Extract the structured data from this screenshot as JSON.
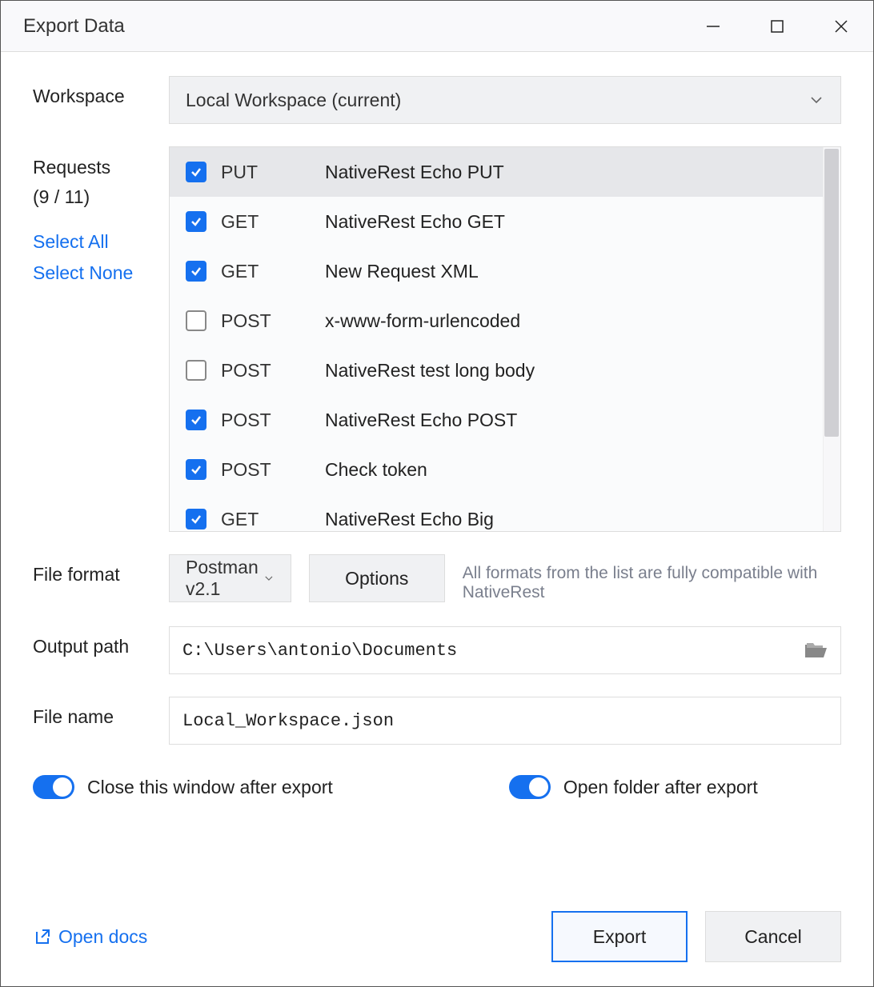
{
  "window": {
    "title": "Export Data"
  },
  "workspace": {
    "label": "Workspace",
    "value": "Local Workspace (current)"
  },
  "requests": {
    "label": "Requests",
    "count_label": "(9 / 11)",
    "select_all": "Select All",
    "select_none": "Select None",
    "items": [
      {
        "checked": true,
        "method": "PUT",
        "name": "NativeRest Echo PUT",
        "selected": true
      },
      {
        "checked": true,
        "method": "GET",
        "name": "NativeRest Echo GET",
        "selected": false
      },
      {
        "checked": true,
        "method": "GET",
        "name": "New Request XML",
        "selected": false
      },
      {
        "checked": false,
        "method": "POST",
        "name": "x-www-form-urlencoded",
        "selected": false
      },
      {
        "checked": false,
        "method": "POST",
        "name": "NativeRest test long body",
        "selected": false
      },
      {
        "checked": true,
        "method": "POST",
        "name": "NativeRest Echo POST",
        "selected": false
      },
      {
        "checked": true,
        "method": "POST",
        "name": "Check token",
        "selected": false
      },
      {
        "checked": true,
        "method": "GET",
        "name": "NativeRest Echo Big",
        "selected": false
      }
    ]
  },
  "format": {
    "label": "File format",
    "value": "Postman v2.1",
    "options_btn": "Options",
    "hint": "All formats from the list are fully compatible with NativeRest"
  },
  "output_path": {
    "label": "Output path",
    "value": "C:\\Users\\antonio\\Documents"
  },
  "file_name": {
    "label": "File name",
    "value": "Local_Workspace.json"
  },
  "toggles": {
    "close_after": {
      "label": "Close this window after export",
      "on": true
    },
    "open_folder": {
      "label": "Open folder after export",
      "on": true
    }
  },
  "footer": {
    "open_docs": "Open docs",
    "export": "Export",
    "cancel": "Cancel"
  }
}
